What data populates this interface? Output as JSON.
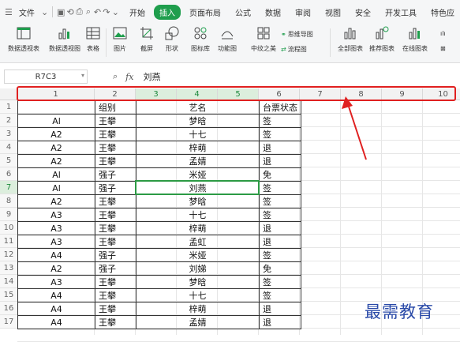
{
  "menubar": {
    "file_label": "文件",
    "tabs": [
      {
        "label": "开始",
        "active": false
      },
      {
        "label": "插入",
        "active": true
      },
      {
        "label": "页面布局",
        "active": false
      },
      {
        "label": "公式",
        "active": false
      },
      {
        "label": "数据",
        "active": false
      },
      {
        "label": "审阅",
        "active": false
      },
      {
        "label": "视图",
        "active": false
      },
      {
        "label": "安全",
        "active": false
      },
      {
        "label": "开发工具",
        "active": false
      },
      {
        "label": "特色应",
        "active": false
      }
    ]
  },
  "ribbon": {
    "pivot_table": "数据透视表",
    "pivot_chart": "数据透视图",
    "table": "表格",
    "picture": "图片",
    "screenshot": "截屏",
    "shape": "形状",
    "icon_lib": "图标库",
    "func_chart": "功能图",
    "chinese_icon": "中纹之美",
    "mindmap": "思维导图",
    "flowchart": "流程图",
    "all_charts": "全部图表",
    "recommended": "推荐图表",
    "online_chart": "在线图表",
    "more1": "ılı",
    "more2": "⊠"
  },
  "formula_bar": {
    "cell_ref": "R7C3",
    "fx": "fx",
    "value": "刘燕"
  },
  "columns": [
    "1",
    "2",
    "3",
    "4",
    "5",
    "6",
    "7",
    "8",
    "9",
    "10"
  ],
  "rows": [
    "1",
    "2",
    "3",
    "4",
    "5",
    "6",
    "7",
    "8",
    "9",
    "10",
    "11",
    "12",
    "13",
    "14",
    "15",
    "16",
    "17"
  ],
  "table": {
    "header": [
      "",
      "组别",
      "艺名",
      "台票状态"
    ],
    "rows": [
      [
        "Al",
        "王攀",
        "梦晗",
        "签"
      ],
      [
        "A2",
        "王攀",
        "十七",
        "签"
      ],
      [
        "A2",
        "王攀",
        "梓萌",
        "退"
      ],
      [
        "A2",
        "王攀",
        "孟婧",
        "退"
      ],
      [
        "Al",
        "强子",
        "米娅",
        "免"
      ],
      [
        "Al",
        "强子",
        "刘燕",
        "签"
      ],
      [
        "A2",
        "王攀",
        "梦晗",
        "签"
      ],
      [
        "A3",
        "王攀",
        "十七",
        "签"
      ],
      [
        "A3",
        "王攀",
        "梓萌",
        "退"
      ],
      [
        "A3",
        "王攀",
        "孟虹",
        "退"
      ],
      [
        "A4",
        "强子",
        "米娅",
        "签"
      ],
      [
        "A2",
        "强子",
        "刘娣",
        "免"
      ],
      [
        "A3",
        "王攀",
        "梦晗",
        "签"
      ],
      [
        "A4",
        "王攀",
        "十七",
        "签"
      ],
      [
        "A4",
        "王攀",
        "梓萌",
        "退"
      ],
      [
        "A4",
        "王攀",
        "孟婧",
        "退"
      ]
    ]
  },
  "watermark": "最需教育",
  "colors": {
    "accent": "#1f9e4d",
    "highlight": "#e02020",
    "watermark": "#2a4aa8"
  }
}
